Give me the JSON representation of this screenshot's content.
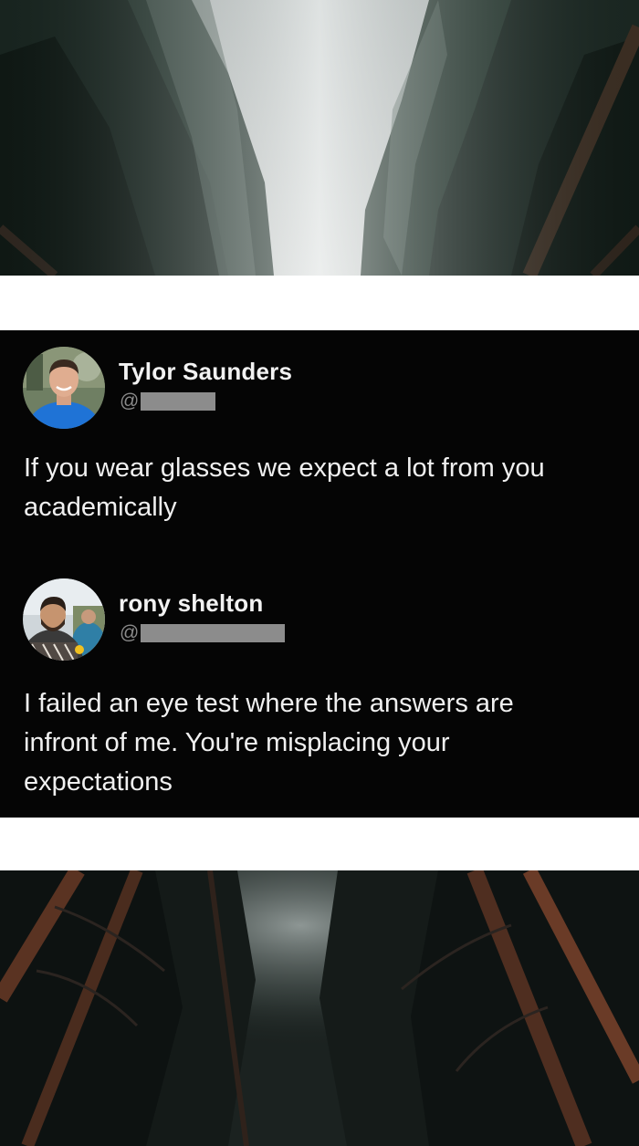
{
  "tweets": [
    {
      "author_name": "Tylor  Saunders",
      "handle_prefix": "@",
      "text": "If you wear glasses we expect a lot from you\nacademically"
    },
    {
      "author_name": "rony shelton",
      "handle_prefix": "@",
      "text": "I failed an eye test where the answers are\ninfront of me. You're misplacing your\nexpectations"
    }
  ],
  "colors": {
    "card_background": "#050505",
    "text": "#f0f0f0",
    "handle": "#8a8a8a",
    "redaction": "#8c8c8c",
    "page_background": "#ffffff"
  }
}
